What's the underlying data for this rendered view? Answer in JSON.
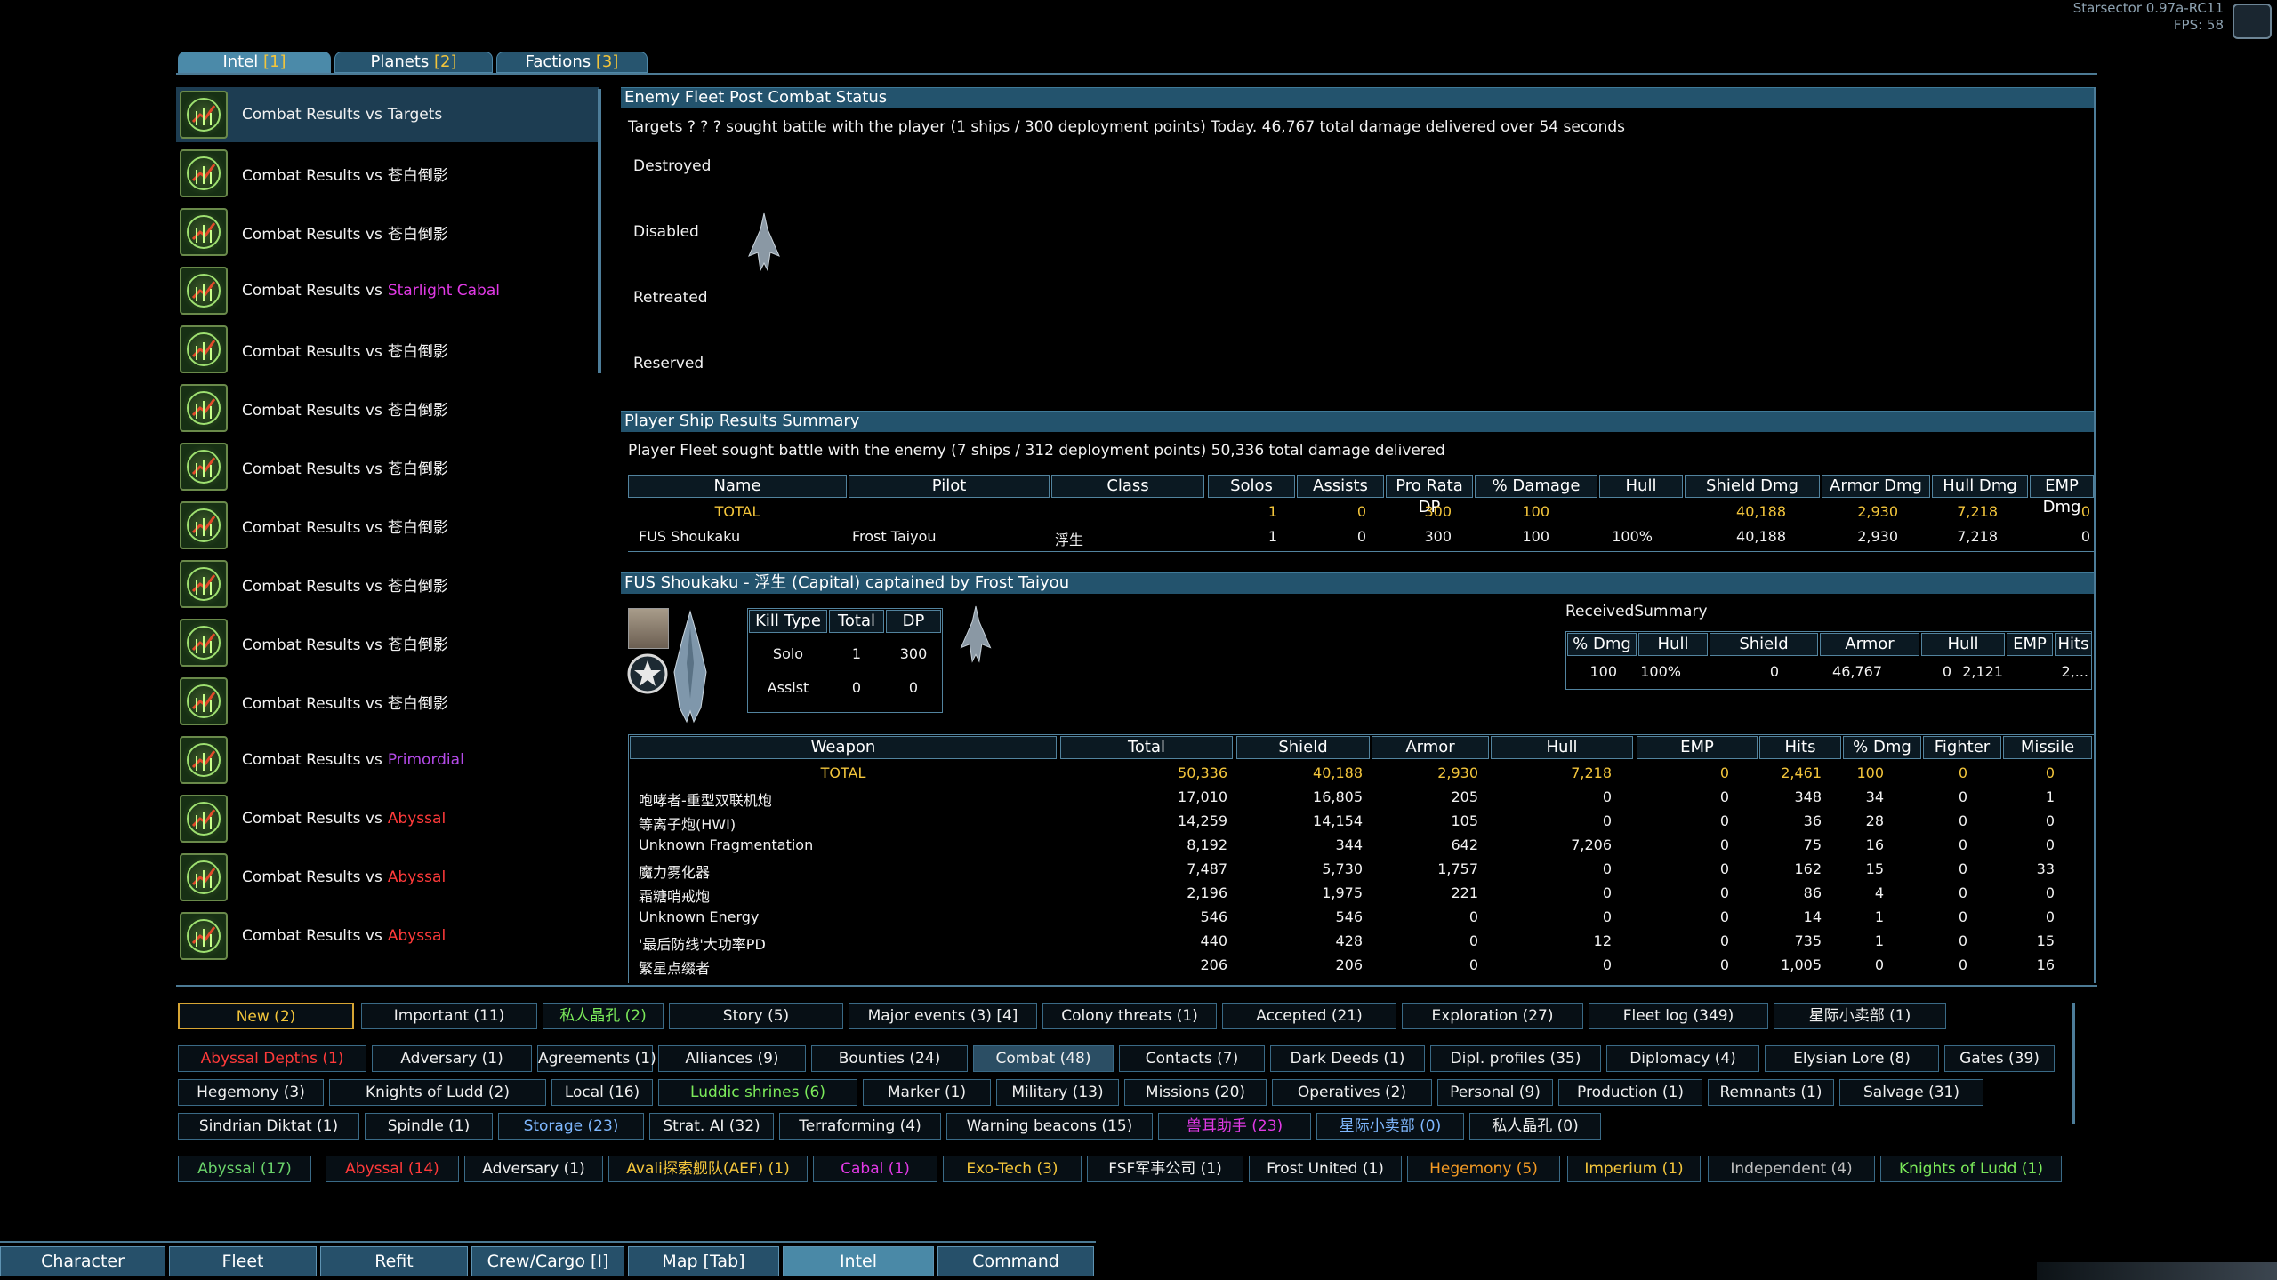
{
  "topinfo": {
    "line1": "Starsector 0.97a-RC11",
    "line2": "FPS: 58"
  },
  "tabs": [
    {
      "label": "Intel",
      "num": "[1]"
    },
    {
      "label": "Planets",
      "num": "[2]"
    },
    {
      "label": "Factions",
      "num": "[3]"
    }
  ],
  "left_items": [
    {
      "prefix": "Combat Results vs",
      "faction": "Targets",
      "color": "#f2f2f2"
    },
    {
      "prefix": "Combat Results vs",
      "faction": "苍白倒影",
      "color": "#f2f2f2"
    },
    {
      "prefix": "Combat Results vs",
      "faction": "苍白倒影",
      "color": "#f2f2f2"
    },
    {
      "prefix": "Combat Results vs",
      "faction": "Starlight Cabal",
      "color": "#e23ae6"
    },
    {
      "prefix": "Combat Results vs",
      "faction": "苍白倒影",
      "color": "#f2f2f2"
    },
    {
      "prefix": "Combat Results vs",
      "faction": "苍白倒影",
      "color": "#f2f2f2"
    },
    {
      "prefix": "Combat Results vs",
      "faction": "苍白倒影",
      "color": "#f2f2f2"
    },
    {
      "prefix": "Combat Results vs",
      "faction": "苍白倒影",
      "color": "#f2f2f2"
    },
    {
      "prefix": "Combat Results vs",
      "faction": "苍白倒影",
      "color": "#f2f2f2"
    },
    {
      "prefix": "Combat Results vs",
      "faction": "苍白倒影",
      "color": "#f2f2f2"
    },
    {
      "prefix": "Combat Results vs",
      "faction": "苍白倒影",
      "color": "#f2f2f2"
    },
    {
      "prefix": "Combat Results vs",
      "faction": "Primordial",
      "color": "#b44ae8"
    },
    {
      "prefix": "Combat Results vs",
      "faction": "Abyssal",
      "color": "#ff3a3a"
    },
    {
      "prefix": "Combat Results vs",
      "faction": "Abyssal",
      "color": "#ff3a3a"
    },
    {
      "prefix": "Combat Results vs",
      "faction": "Abyssal",
      "color": "#ff3a3a"
    }
  ],
  "enemy": {
    "title": "Enemy Fleet Post Combat Status",
    "summary": "Targets ? ? ? sought battle with the player (1 ships / 300 deployment points) Today. 46,767 total damage delivered over 54 seconds",
    "rows": [
      "Destroyed",
      "Disabled",
      "Retreated",
      "Reserved"
    ]
  },
  "player": {
    "title": "Player Ship Results Summary",
    "summary": "Player Fleet sought battle with the enemy (7 ships / 312 deployment points) 50,336 total damage delivered",
    "headers": [
      "Name",
      "Pilot",
      "Class",
      "Solos",
      "Assists",
      "Pro Rata DP",
      "% Damage",
      "Hull",
      "Shield Dmg",
      "Armor Dmg",
      "Hull Dmg",
      "EMP Dmg"
    ],
    "total": [
      "TOTAL",
      "",
      "",
      "1",
      "0",
      "300",
      "100",
      "",
      "40,188",
      "2,930",
      "7,218",
      "0"
    ],
    "row": [
      "FUS Shoukaku",
      "Frost Taiyou",
      "浮生",
      "1",
      "0",
      "300",
      "100",
      "100%",
      "40,188",
      "2,930",
      "7,218",
      "0"
    ]
  },
  "ship": {
    "title": "FUS Shoukaku - 浮生 (Capital) captained by Frost Taiyou",
    "kill_headers": [
      "Kill Type",
      "Total",
      "DP"
    ],
    "kills": [
      [
        "Solo",
        "1",
        "300"
      ],
      [
        "Assist",
        "0",
        "0"
      ]
    ],
    "received_title": "ReceivedSummary",
    "received_headers": [
      "% Dmg",
      "Hull",
      "Shield",
      "Armor",
      "Hull",
      "EMP",
      "Hits"
    ],
    "received_row": [
      "100",
      "100%",
      "0",
      "46,767",
      "0",
      "2,121",
      "2,..."
    ]
  },
  "weapons": {
    "headers": [
      "Weapon",
      "Total",
      "Shield",
      "Armor",
      "Hull",
      "EMP",
      "Hits",
      "% Dmg",
      "Fighter",
      "Missile"
    ],
    "total": [
      "TOTAL",
      "50,336",
      "40,188",
      "2,930",
      "7,218",
      "0",
      "2,461",
      "100",
      "0",
      "0"
    ],
    "rows": [
      [
        "咆哮者-重型双联机炮",
        "17,010",
        "16,805",
        "205",
        "0",
        "0",
        "348",
        "34",
        "0",
        "1"
      ],
      [
        "等离子炮(HWI)",
        "14,259",
        "14,154",
        "105",
        "0",
        "0",
        "36",
        "28",
        "0",
        "0"
      ],
      [
        "Unknown Fragmentation",
        "8,192",
        "344",
        "642",
        "7,206",
        "0",
        "75",
        "16",
        "0",
        "0"
      ],
      [
        "魔力雾化器",
        "7,487",
        "5,730",
        "1,757",
        "0",
        "0",
        "162",
        "15",
        "0",
        "33"
      ],
      [
        "霜糖哨戒炮",
        "2,196",
        "1,975",
        "221",
        "0",
        "0",
        "86",
        "4",
        "0",
        "0"
      ],
      [
        "Unknown Energy",
        "546",
        "546",
        "0",
        "0",
        "0",
        "14",
        "1",
        "0",
        "0"
      ],
      [
        "'最后防线'大功率PD",
        "440",
        "428",
        "0",
        "12",
        "0",
        "735",
        "1",
        "0",
        "15"
      ],
      [
        "繁星点缀者",
        "206",
        "206",
        "0",
        "0",
        "0",
        "1,005",
        "0",
        "0",
        "16"
      ]
    ]
  },
  "filters_row1": [
    {
      "label": "New (2)",
      "color": "#f3c53b"
    },
    {
      "label": "Important (11)",
      "color": "#f0f0f0"
    },
    {
      "label": "私人晶孔 (2)",
      "color": "#7bea5a"
    },
    {
      "label": "Story (5)",
      "color": "#f0f0f0"
    },
    {
      "label": "Major events (3) [4]",
      "color": "#f0f0f0"
    },
    {
      "label": "Colony threats (1)",
      "color": "#f0f0f0"
    },
    {
      "label": "Accepted (21)",
      "color": "#f0f0f0"
    },
    {
      "label": "Exploration (27)",
      "color": "#f0f0f0"
    },
    {
      "label": "Fleet log (349)",
      "color": "#f0f0f0"
    },
    {
      "label": "星际小卖部 (1)",
      "color": "#f0f0f0"
    }
  ],
  "filters_row2": [
    {
      "label": "Abyssal Depths (1)",
      "color": "#ff3a3a"
    },
    {
      "label": "Adversary (1)",
      "color": "#f0f0f0"
    },
    {
      "label": "Agreements (1)",
      "color": "#f0f0f0"
    },
    {
      "label": "Alliances (9)",
      "color": "#f0f0f0"
    },
    {
      "label": "Bounties (24)",
      "color": "#f0f0f0"
    },
    {
      "label": "Combat (48)",
      "color": "#f0f0f0"
    },
    {
      "label": "Contacts (7)",
      "color": "#f0f0f0"
    },
    {
      "label": "Dark Deeds (1)",
      "color": "#f0f0f0"
    },
    {
      "label": "Dipl. profiles (35)",
      "color": "#f0f0f0"
    },
    {
      "label": "Diplomacy (4)",
      "color": "#f0f0f0"
    },
    {
      "label": "Elysian Lore (8)",
      "color": "#f0f0f0"
    },
    {
      "label": "Gates (39)",
      "color": "#f0f0f0"
    }
  ],
  "filters_row3": [
    {
      "label": "Hegemony (3)",
      "color": "#f0f0f0"
    },
    {
      "label": "Knights of Ludd (2)",
      "color": "#f0f0f0"
    },
    {
      "label": "Local (16)",
      "color": "#f0f0f0"
    },
    {
      "label": "Luddic shrines (6)",
      "color": "#7bea5a"
    },
    {
      "label": "Marker (1)",
      "color": "#f0f0f0"
    },
    {
      "label": "Military (13)",
      "color": "#f0f0f0"
    },
    {
      "label": "Missions (20)",
      "color": "#f0f0f0"
    },
    {
      "label": "Operatives (2)",
      "color": "#f0f0f0"
    },
    {
      "label": "Personal (9)",
      "color": "#f0f0f0"
    },
    {
      "label": "Production (1)",
      "color": "#f0f0f0"
    },
    {
      "label": "Remnants (1)",
      "color": "#f0f0f0"
    },
    {
      "label": "Salvage (31)",
      "color": "#f0f0f0"
    }
  ],
  "filters_row4": [
    {
      "label": "Sindrian Diktat (1)",
      "color": "#f0f0f0"
    },
    {
      "label": "Spindle (1)",
      "color": "#f0f0f0"
    },
    {
      "label": "Storage (23)",
      "color": "#7fb8ff"
    },
    {
      "label": "Strat. AI (32)",
      "color": "#f0f0f0"
    },
    {
      "label": "Terraforming (4)",
      "color": "#f0f0f0"
    },
    {
      "label": "Warning beacons (15)",
      "color": "#f0f0f0"
    },
    {
      "label": "兽耳助手 (23)",
      "color": "#e23ae6"
    },
    {
      "label": "星际小卖部 (0)",
      "color": "#7fb8ff"
    },
    {
      "label": "私人晶孔 (0)",
      "color": "#f0f0f0"
    }
  ],
  "factions": [
    {
      "label": "Abyssal (17)",
      "color": "#6bd46b"
    },
    {
      "label": "Abyssal (14)",
      "color": "#ff3a3a"
    },
    {
      "label": "Adversary (1)",
      "color": "#f0f0f0"
    },
    {
      "label": "Avali探索舰队(AEF) (1)",
      "color": "#f3c53b"
    },
    {
      "label": "Cabal (1)",
      "color": "#e23ae6"
    },
    {
      "label": "Exo-Tech (3)",
      "color": "#f3c53b"
    },
    {
      "label": "FSF军事公司 (1)",
      "color": "#f0f0f0"
    },
    {
      "label": "Frost United (1)",
      "color": "#f0f0f0"
    },
    {
      "label": "Hegemony (5)",
      "color": "#f39a24"
    },
    {
      "label": "Imperium (1)",
      "color": "#f3c53b"
    },
    {
      "label": "Independent (4)",
      "color": "#c0c0c0"
    },
    {
      "label": "Knights of Ludd (1)",
      "color": "#7bea5a"
    }
  ],
  "bottom": [
    {
      "label": "Character",
      "u": "C"
    },
    {
      "label": "Fleet",
      "u": "F"
    },
    {
      "label": "Refit",
      "u": "R"
    },
    {
      "label": "Crew/Cargo [I]",
      "u": ""
    },
    {
      "label": "Map [Tab]",
      "u": ""
    },
    {
      "label": "Intel",
      "u": "e"
    },
    {
      "label": "Command",
      "u": "d"
    }
  ]
}
